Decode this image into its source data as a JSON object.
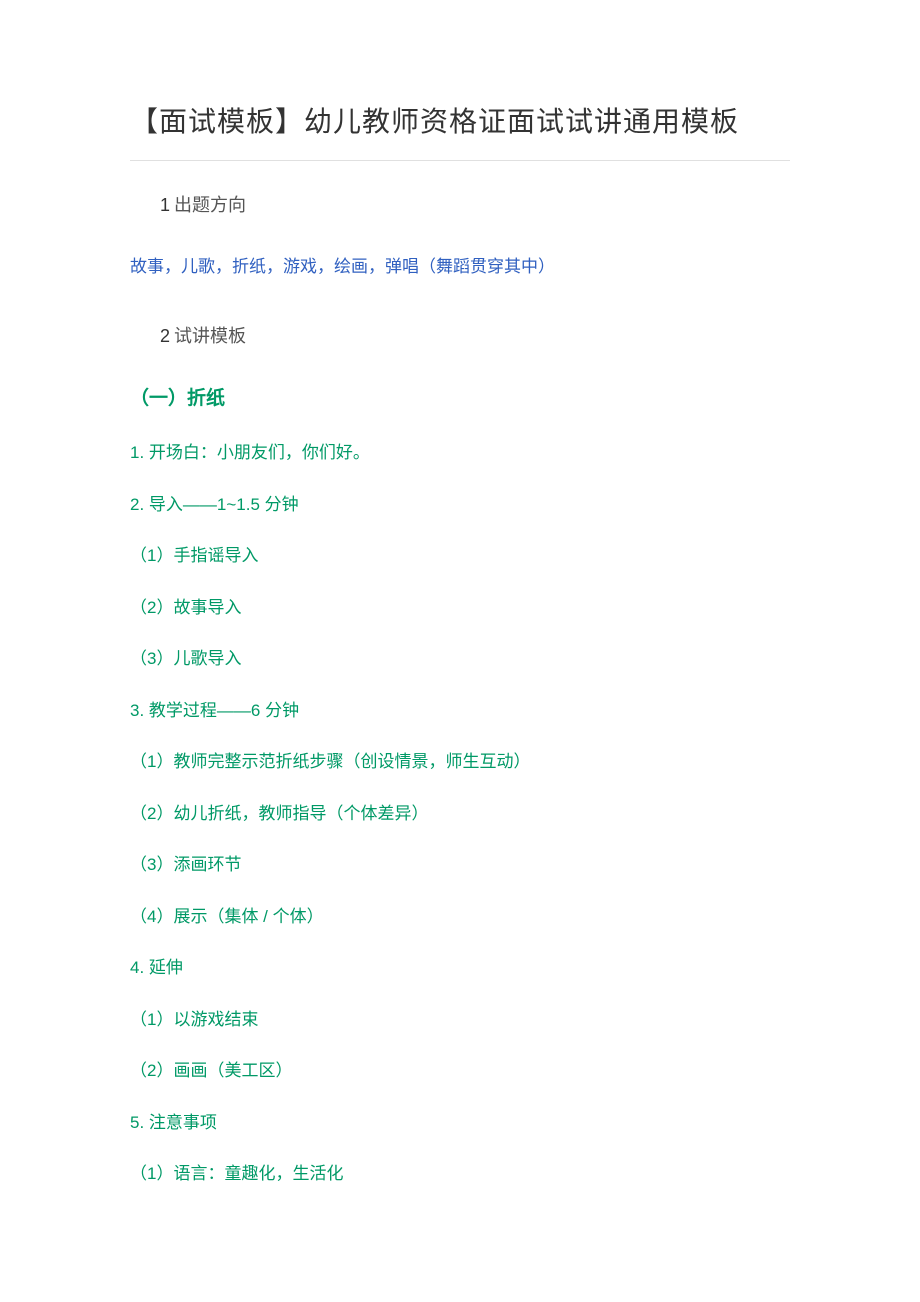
{
  "title": "【面试模板】幼儿教师资格证面试试讲通用模板",
  "sec1": {
    "num": "1",
    "label": "出题方向"
  },
  "categories": "故事，儿歌，折纸，游戏，绘画，弹唱（舞蹈贯穿其中）",
  "sec2": {
    "num": "2",
    "label": "试讲模板"
  },
  "sub1": "（一）折纸",
  "lines": {
    "l1": "1. 开场白：小朋友们，你们好。",
    "l2": "2. 导入——1~1.5 分钟",
    "l3": "（1）手指谣导入",
    "l4": "（2）故事导入",
    "l5": "（3）儿歌导入",
    "l6": "3. 教学过程——6 分钟",
    "l7": "（1）教师完整示范折纸步骤（创设情景，师生互动）",
    "l8": "（2）幼儿折纸，教师指导（个体差异）",
    "l9": "（3）添画环节",
    "l10": "（4）展示（集体 / 个体）",
    "l11": "4. 延伸",
    "l12": "（1）以游戏结束",
    "l13": "（2）画画（美工区）",
    "l14": "5. 注意事项",
    "l15": "（1）语言：童趣化，生活化"
  }
}
